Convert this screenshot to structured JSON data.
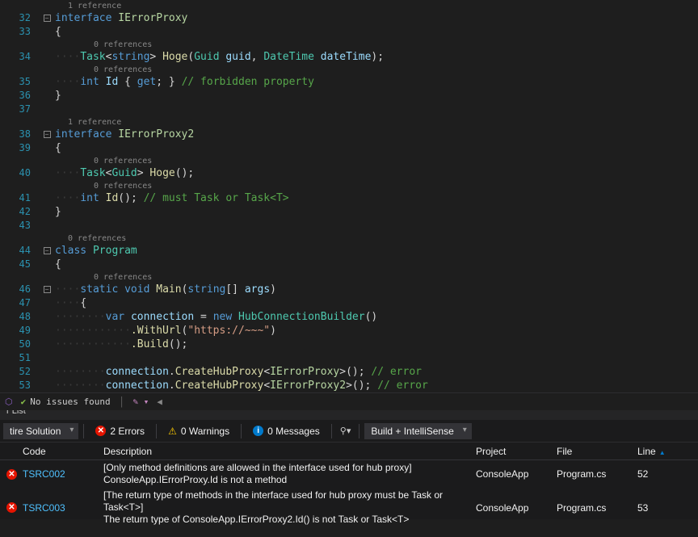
{
  "code": {
    "l32_ref": "1 reference",
    "l34_ref": "0 references",
    "l35_ref": "0 references",
    "l38_ref": "1 reference",
    "l40_ref": "0 references",
    "l41_ref": "0 references",
    "l44_ref": "0 references",
    "l46_ref": "0 references",
    "n32": "32",
    "n33": "33",
    "n34": "34",
    "n35": "35",
    "n36": "36",
    "n37": "37",
    "n38": "38",
    "n39": "39",
    "n40": "40",
    "n41": "41",
    "n42": "42",
    "n43": "43",
    "n44": "44",
    "n45": "45",
    "n46": "46",
    "n47": "47",
    "n48": "48",
    "n49": "49",
    "n50": "50",
    "n51": "51",
    "n52": "52",
    "n53": "53"
  },
  "tokens": {
    "interface": "interface",
    "IErrorProxy": "IErrorProxy",
    "IErrorProxy2": "IErrorProxy2",
    "lbrace": "{",
    "rbrace": "}",
    "Task": "Task",
    "string": "string",
    "Guid": "Guid",
    "DateTime": "DateTime",
    "Hoge": "Hoge",
    "guid": "guid",
    "dateTime": "dateTime",
    "int": "int",
    "Id": "Id",
    "get": "get",
    "comment_forbidden": "// forbidden property",
    "comment_must": "// must Task or Task<T>",
    "class": "class",
    "Program": "Program",
    "static": "static",
    "void": "void",
    "Main": "Main",
    "args": "args",
    "var": "var",
    "connection": "connection",
    "new": "new",
    "HubConnectionBuilder": "HubConnectionBuilder",
    "WithUrl": ".WithUrl",
    "Build": ".Build",
    "url": "\"https://~~~\"",
    "CreateHubProxy": "CreateHubProxy",
    "comment_error": "// error",
    "lt": "<",
    "gt": ">",
    "lparen": "(",
    "rparen": ")",
    "comma": ", ",
    "semi": ";",
    "eq": " = ",
    "dot": ".",
    "sqb": "[]"
  },
  "status": {
    "issues": "No issues found"
  },
  "errorlist": {
    "title": "r List",
    "scope": "tire Solution",
    "errors": "2 Errors",
    "warnings": "0 Warnings",
    "messages": "0 Messages",
    "source": "Build + IntelliSense",
    "hdr_code": "Code",
    "hdr_desc": "Description",
    "hdr_project": "Project",
    "hdr_file": "File",
    "hdr_line": "Line",
    "rows": [
      {
        "code": "TSRC002",
        "desc": "[Only method definitions are allowed in the interface used for hub proxy]\nConsoleApp.IErrorProxy.Id is not a method",
        "project": "ConsoleApp",
        "file": "Program.cs",
        "line": "52"
      },
      {
        "code": "TSRC003",
        "desc": "[The return type of methods in the interface used for hub proxy must be Task or Task<T>]\nThe return type of ConsoleApp.IErrorProxy2.Id() is not Task or Task<T>",
        "project": "ConsoleApp",
        "file": "Program.cs",
        "line": "53"
      }
    ]
  }
}
